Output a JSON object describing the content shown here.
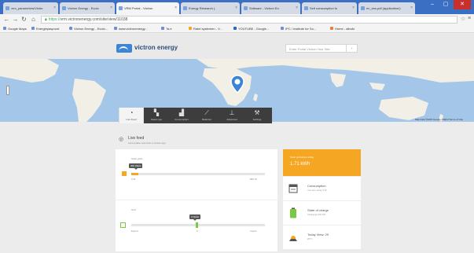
{
  "browser": {
    "tabs": [
      {
        "label": "vrm_parameters/Victro",
        "active": false
      },
      {
        "label": "Victron Energy - Ecolo",
        "active": false
      },
      {
        "label": "VRM Portal - Victron",
        "active": true
      },
      {
        "label": "Energy Research (.",
        "active": false
      },
      {
        "label": "Software - Victron En",
        "active": false
      },
      {
        "label": "Self consumption fo",
        "active": false
      },
      {
        "label": "en_ess.pdf (application/)",
        "active": false
      }
    ],
    "url_secure": "https://",
    "url_host": "vrm.victronenergy.com",
    "url_path": "/site/view/11038",
    "bookmarks": [
      "Google Maps",
      "Energiepaspoort",
      "Victron Energy - Ecolo...",
      "www.victronenergy...",
      "Ta.e",
      "Ratel systemen - V...",
      "YOUTUBE - Google...",
      "IPC / Institute for So...",
      "Home - albufo"
    ],
    "window_buttons": {
      "minimize": "–",
      "maximize": "▢",
      "close": "✕"
    }
  },
  "site": {
    "logo_text": "victron energy",
    "search_placeholder": "Enter Portal Victron Your Site"
  },
  "map": {
    "credit": "Map data ©2015 Google, INEGI   Terms of Use"
  },
  "nav": {
    "items": [
      {
        "label": "Live Feed",
        "icon": "gauge-icon",
        "glyph": "◔",
        "active": true
      },
      {
        "label": "Data-Logs",
        "icon": "bars-icon",
        "glyph": "▚",
        "active": false
      },
      {
        "label": "Consumption",
        "icon": "chart-icon",
        "glyph": "▟",
        "active": false
      },
      {
        "label": "Batteries",
        "icon": "wrench-icon",
        "glyph": "⟋",
        "active": false
      },
      {
        "label": "Advanced",
        "icon": "graph-icon",
        "glyph": "⊥",
        "active": false
      },
      {
        "label": "Settings",
        "icon": "wrench-settings-icon",
        "glyph": "⚒",
        "active": false
      }
    ]
  },
  "feed": {
    "title": "Live feed",
    "subtitle": "Last update: less than a minute ago"
  },
  "sliders": {
    "solar": {
      "label": "Solar yield",
      "tooltip": "300 Watts",
      "left": "0 W",
      "right": "860 W",
      "value_fraction": 0.05
    },
    "grid": {
      "label": "Grid",
      "tooltip": "0 Watts",
      "left": "Export",
      "mid": "0",
      "right": "Import",
      "value_fraction": 0.5
    }
  },
  "cards": {
    "solar": {
      "title": "Solar production today",
      "value": "1.71 kWh"
    },
    "consumption": {
      "title": "Consumption",
      "sub": "You are using 0 W"
    },
    "battery": {
      "title": "State of charge",
      "sub": "Charging 100.0%"
    },
    "weather": {
      "title": "Today View: 29",
      "sub": "29°C"
    }
  },
  "colors": {
    "accent": "#f5a623",
    "tabbar": "#3a6fc4",
    "nav": "#3d3d3d",
    "ocean": "#a4c6e8",
    "land": "#f2efe6",
    "battery_green": "#7ac943"
  }
}
